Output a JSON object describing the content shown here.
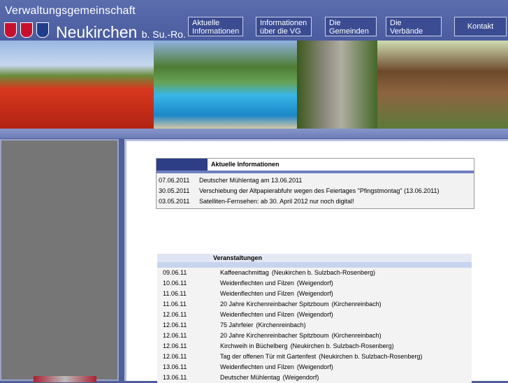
{
  "header": {
    "org_title": "Verwaltungsgemeinschaft",
    "place_main": "Neukirchen",
    "place_suffix": "b. Su.-Ro.",
    "crest_colors": [
      "#c8102e",
      "#c8102e",
      "#1f3d8a"
    ]
  },
  "nav": [
    {
      "line1": "Aktuelle",
      "line2": "Informationen"
    },
    {
      "line1": "Informationen",
      "line2": "über die VG"
    },
    {
      "line1": "Die",
      "line2": "Gemeinden"
    },
    {
      "line1": "Die",
      "line2": "Verbände"
    },
    {
      "line1": "Kontakt",
      "line2": ""
    }
  ],
  "news": {
    "heading": "Aktuelle Informationen",
    "items": [
      {
        "date": "07.06.2011",
        "text": "Deutscher Mühlentag am 13.06.2011"
      },
      {
        "date": "30.05.2011",
        "text": "Verschiebung der Altpapierabfuhr wegen des Feiertages \"Pfingstmontag\" (13.06.2011)"
      },
      {
        "date": "03.05.2011",
        "text": "Satelliten-Fernsehen: ab 30. April 2012 nur noch digital!"
      }
    ]
  },
  "events": {
    "heading": "Veranstaltungen",
    "items": [
      {
        "date": "09.06.11",
        "title": "Kaffeenachmittag",
        "place": "(Neukirchen b. Sulzbach-Rosenberg)"
      },
      {
        "date": "10.06.11",
        "title": "Weidenflechten und Filzen",
        "place": "(Weigendorf)"
      },
      {
        "date": "11.06.11",
        "title": "Weidenflechten und Filzen",
        "place": "(Weigendorf)"
      },
      {
        "date": "11.06.11",
        "title": "20 Jahre Kirchenreinbacher Spitzboum",
        "place": "(Kirchenreinbach)"
      },
      {
        "date": "12.06.11",
        "title": "Weidenflechten und Filzen",
        "place": "(Weigendorf)"
      },
      {
        "date": "12.06.11",
        "title": "75 Jahrfeier",
        "place": "(Kirchenreinbach)"
      },
      {
        "date": "12.06.11",
        "title": "20 Jahre Kirchenreinbacher Spitzboum",
        "place": "(Kirchenreinbach)"
      },
      {
        "date": "12.06.11",
        "title": "Kirchweih in Büchelberg",
        "place": "(Neukirchen b. Sulzbach-Rosenberg)"
      },
      {
        "date": "12.06.11",
        "title": "Tag der offenen Tür mit Gartenfest",
        "place": "(Neukirchen b. Sulzbach-Rosenberg)"
      },
      {
        "date": "13.06.11",
        "title": "Weidenflechten und Filzen",
        "place": "(Weigendorf)"
      },
      {
        "date": "13.06.11",
        "title": "Deutscher Mühlentag",
        "place": "(Weigendorf)"
      }
    ]
  }
}
